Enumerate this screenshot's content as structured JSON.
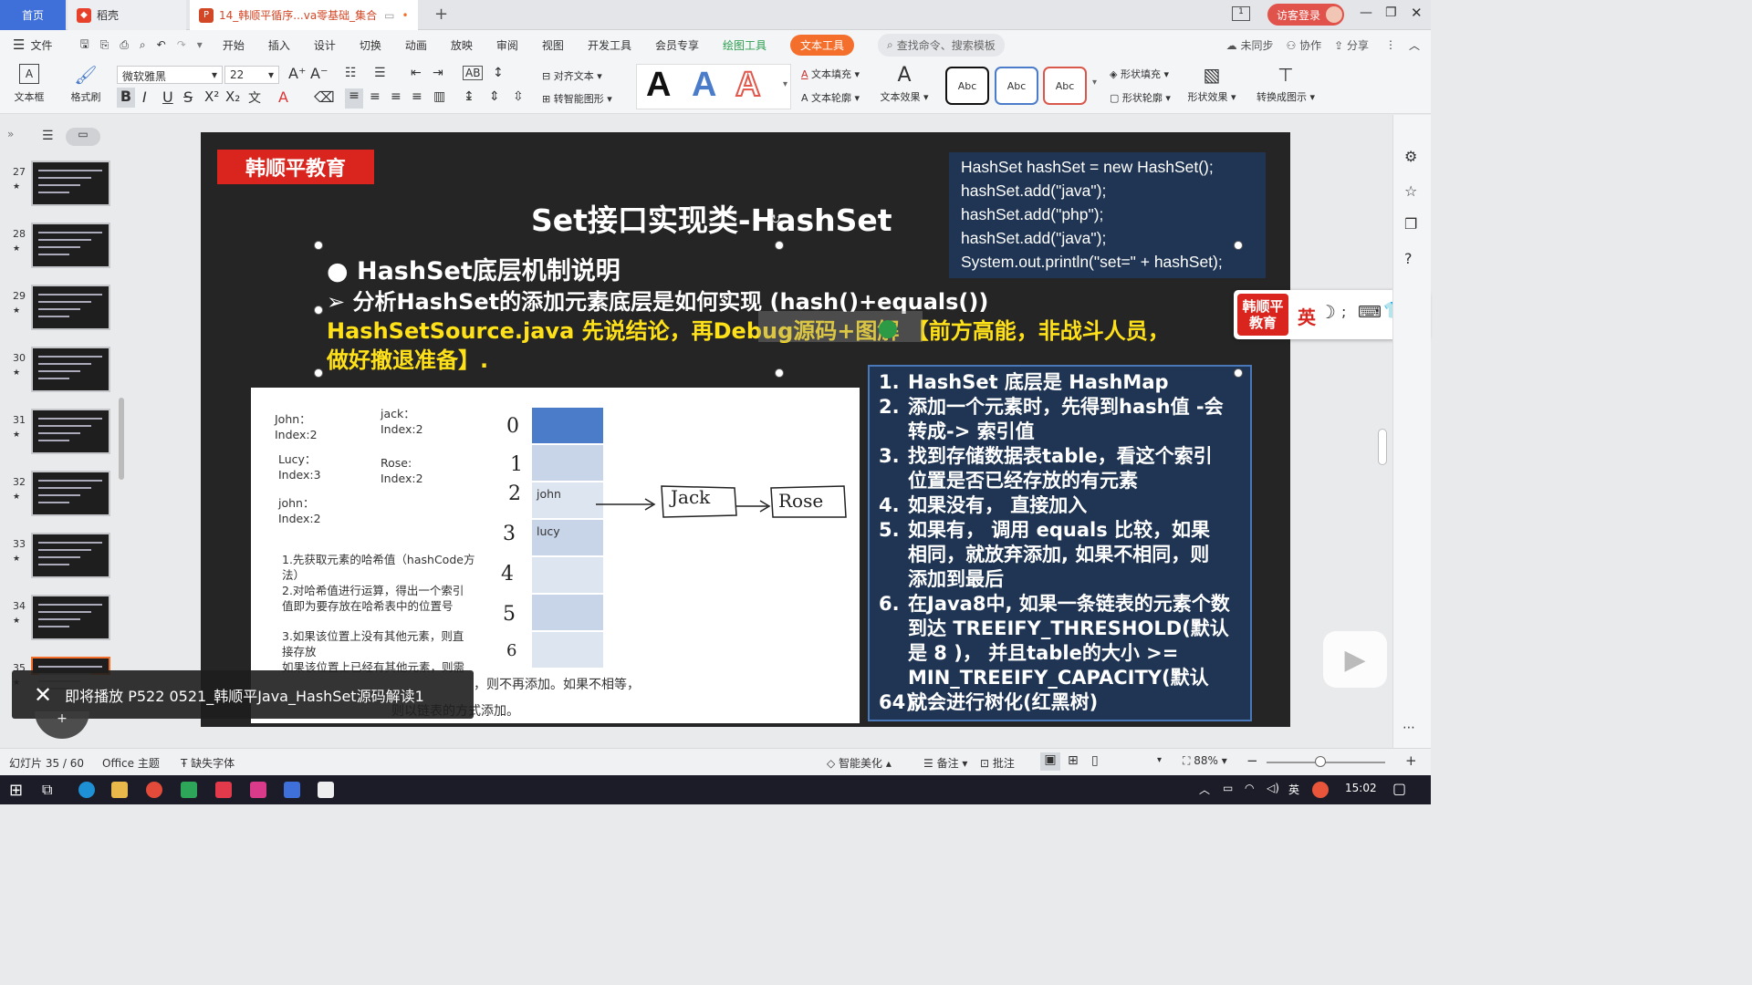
{
  "tabs": {
    "home": "首页",
    "docer": "稻壳",
    "document": "14_韩顺平循序...va零基础_集合"
  },
  "window": {
    "login": "访客登录"
  },
  "menu": {
    "file": "文件",
    "items": [
      "开始",
      "插入",
      "设计",
      "切换",
      "动画",
      "放映",
      "审阅",
      "视图",
      "开发工具",
      "会员专享"
    ],
    "drawing_tools": "绘图工具",
    "text_tools": "文本工具",
    "search": "查找命令、搜索模板",
    "sync": "未同步",
    "collab": "协作",
    "share": "分享"
  },
  "ribbon": {
    "textbox": "文本框",
    "format_painter": "格式刷",
    "font_name": "微软雅黑",
    "font_size": "22",
    "align_text": "对齐文本",
    "smart_shape": "转智能图形",
    "text_fill": "文本填充",
    "text_outline": "文本轮廓",
    "text_effect": "文本效果",
    "abc_label": "Abc",
    "shape_fill": "形状填充",
    "shape_outline": "形状轮廓",
    "shape_effect": "形状效果",
    "convert_chart": "转换成图示",
    "bigA": "A"
  },
  "sidebar": {
    "thumbs": [
      "27",
      "28",
      "29",
      "30",
      "31",
      "32",
      "33",
      "34",
      "35"
    ]
  },
  "slide": {
    "brand": "韩顺平教育",
    "title": "Set接口实现类-HashSet",
    "code_lines": [
      "HashSet hashSet = new HashSet();",
      "hashSet.add(\"java\");",
      "hashSet.add(\"php\");",
      "hashSet.add(\"java\");",
      "System.out.println(\"set=\" + hashSet);"
    ],
    "bullet1": "HashSet底层机制说明",
    "bullet2": "分析HashSet的添加元素底层是如何实现 (hash()+equals())",
    "yellow_line1": "HashSetSource.java  先说结论，再Debug源码+图解 【前方高能，非战斗人员，",
    "yellow_line2": "做好撤退准备】.",
    "diagram": {
      "entries": [
        {
          "name": "John：",
          "index": "Index:2"
        },
        {
          "name": "jack：",
          "index": "Index:2"
        },
        {
          "name": "Lucy：",
          "index": "Index:3"
        },
        {
          "name": "Rose:",
          "index": "Index:2"
        },
        {
          "name": "john：",
          "index": "Index:2"
        }
      ],
      "notes": [
        "1.先获取元素的哈希值（hashCode方",
        "法）",
        "2.对哈希值进行运算，得出一个索引",
        "值即为要存放在哈希表中的位置号",
        "3.如果该位置上没有其他元素，则直",
        "接存放",
        "如果该位置上已经有其他元素，则需"
      ],
      "note_tail1": "，则不再添加。如果不相等，",
      "note_tail2": "则以链表的方式添加。",
      "indices": [
        "0",
        "1",
        "2",
        "3",
        "4",
        "5",
        "6"
      ],
      "cell_john": "john",
      "cell_lucy": "lucy",
      "node_jack": "Jack",
      "node_rose": "Rose"
    },
    "steps": [
      {
        "n": "1.",
        "lines": [
          "HashSet 底层是 HashMap"
        ]
      },
      {
        "n": "2.",
        "lines": [
          "添加一个元素时，先得到hash值 -会",
          "转成-> 索引值"
        ]
      },
      {
        "n": "3.",
        "lines": [
          "找到存储数据表table，看这个索引",
          "位置是否已经存放的有元素"
        ]
      },
      {
        "n": "4.",
        "lines": [
          "如果没有，  直接加入"
        ]
      },
      {
        "n": "5.",
        "lines": [
          "如果有，  调用 equals 比较，如果",
          "相同，就放弃添加, 如果不相同，则",
          "添加到最后"
        ]
      },
      {
        "n": "6.",
        "lines": [
          "在Java8中, 如果一条链表的元素个数",
          "到达 TREEIFY_THRESHOLD(默认",
          "是 8 )，  并且table的大小 >=",
          "MIN_TREEIFY_CAPACITY(默认64),",
          "就会进行树化(红黑树)"
        ]
      }
    ]
  },
  "ime": {
    "brand": "韩顺平教育",
    "lang": "英"
  },
  "notification": {
    "text": "即将播放 P522 0521_韩顺平Java_HashSet源码解读1"
  },
  "statusbar": {
    "slide": "幻灯片 35 / 60",
    "theme": "Office 主题",
    "missing_font": "缺失字体",
    "beautify": "智能美化",
    "notes": "备注",
    "comment": "批注",
    "zoom": "88%"
  },
  "taskbar": {
    "ime": "英",
    "time": "15:02"
  },
  "colors": {
    "accent": "#f56f2c",
    "brand_red": "#d9251d",
    "slide_bg": "#252525",
    "code_bg": "#1f3553",
    "highlight_yellow": "#ffe11a"
  }
}
